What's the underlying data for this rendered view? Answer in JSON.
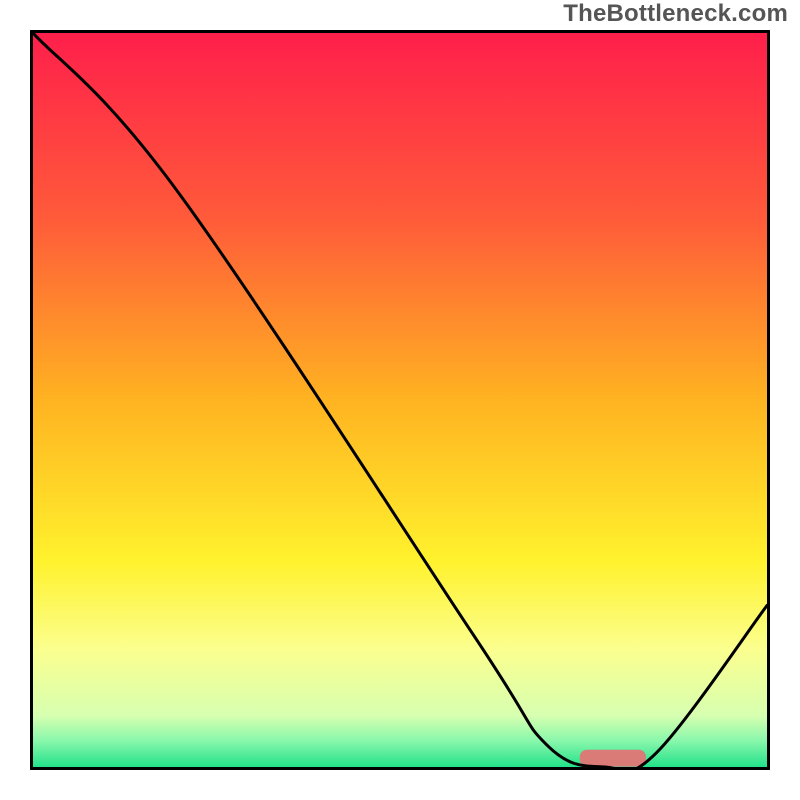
{
  "watermark": {
    "text": "TheBottleneck.com"
  },
  "chart_data": {
    "type": "line",
    "title": "",
    "xlabel": "",
    "ylabel": "",
    "x_range": [
      0,
      100
    ],
    "y_range": [
      0,
      100
    ],
    "series": [
      {
        "name": "bottleneck-curve",
        "x": [
          0,
          20,
          60,
          70,
          78,
          85,
          100
        ],
        "y": [
          100,
          78,
          18,
          3,
          0,
          2,
          22
        ]
      }
    ],
    "background_gradient": {
      "orientation": "vertical",
      "stops": [
        {
          "offset": 0.0,
          "color": "#ff1f4b"
        },
        {
          "offset": 0.25,
          "color": "#ff5a3a"
        },
        {
          "offset": 0.5,
          "color": "#ffb321"
        },
        {
          "offset": 0.72,
          "color": "#fff22d"
        },
        {
          "offset": 0.84,
          "color": "#fbff8f"
        },
        {
          "offset": 0.93,
          "color": "#d7ffb0"
        },
        {
          "offset": 0.965,
          "color": "#87f7ab"
        },
        {
          "offset": 1.0,
          "color": "#23e18a"
        }
      ]
    },
    "marker": {
      "shape": "rounded-bar",
      "x_center": 79,
      "y_center": 1.2,
      "width_x_units": 9,
      "height_y_units": 2.3,
      "color": "#da7b78"
    }
  }
}
